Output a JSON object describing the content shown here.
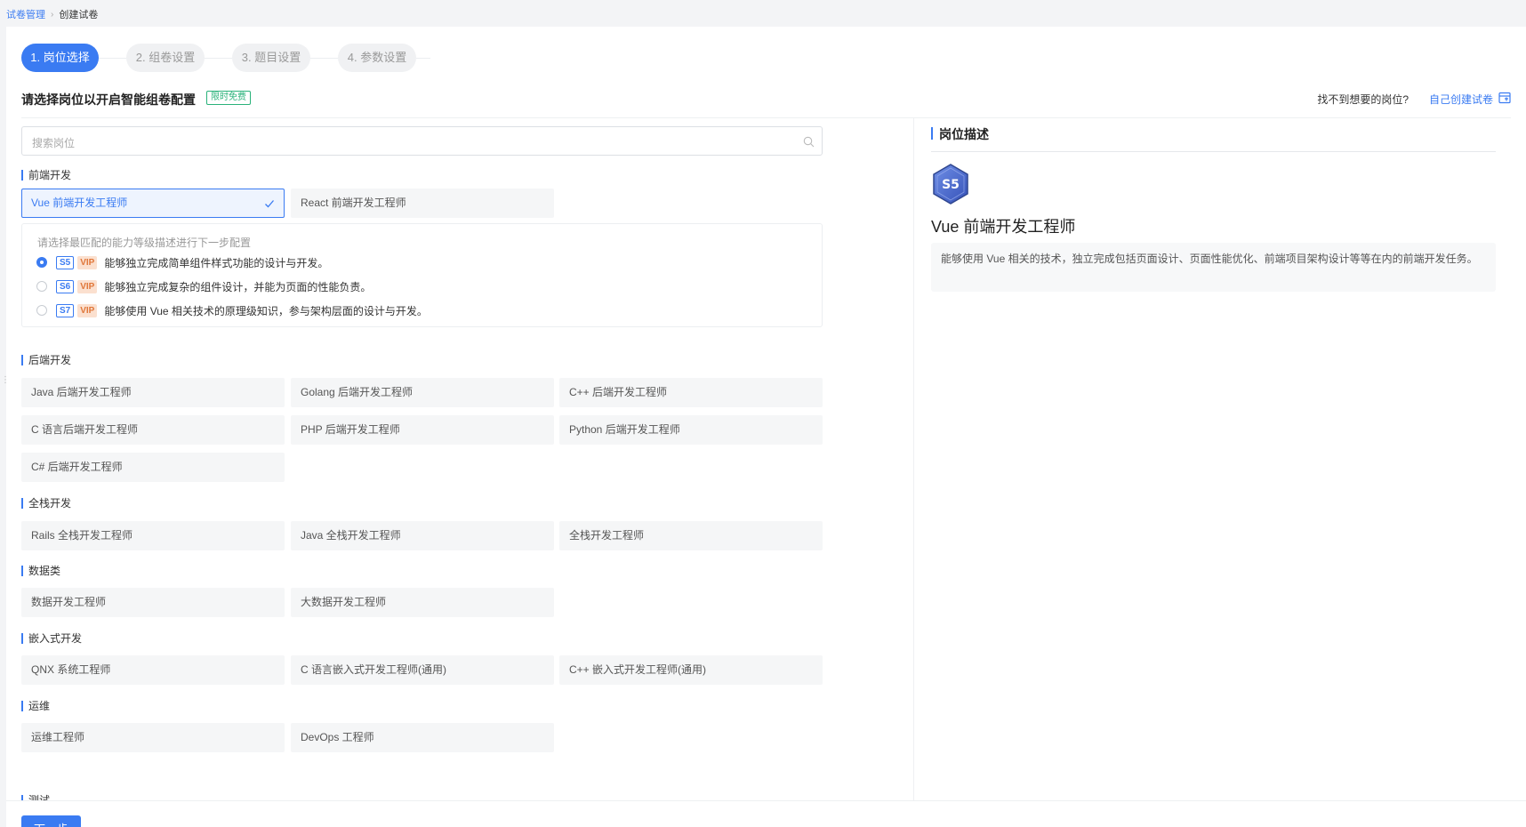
{
  "breadcrumb": {
    "parent": "试卷管理",
    "current": "创建试卷"
  },
  "steps": [
    "1. 岗位选择",
    "2. 组卷设置",
    "3. 题目设置",
    "4. 参数设置"
  ],
  "header": {
    "title": "请选择岗位以开启智能组卷配置",
    "badge": "限时免费",
    "cant_find": "找不到想要的岗位?",
    "self_create": "自己创建试卷"
  },
  "search": {
    "placeholder": "搜索岗位"
  },
  "categories": {
    "frontend": {
      "label": "前端开发",
      "items": [
        "Vue 前端开发工程师",
        "React 前端开发工程师"
      ]
    },
    "backend": {
      "label": "后端开发",
      "items": [
        "Java 后端开发工程师",
        "Golang 后端开发工程师",
        "C++ 后端开发工程师",
        "C 语言后端开发工程师",
        "PHP 后端开发工程师",
        "Python 后端开发工程师",
        "C# 后端开发工程师"
      ]
    },
    "fullstack": {
      "label": "全栈开发",
      "items": [
        "Rails 全栈开发工程师",
        "Java 全栈开发工程师",
        "全栈开发工程师"
      ]
    },
    "data": {
      "label": "数据类",
      "items": [
        "数据开发工程师",
        "大数据开发工程师"
      ]
    },
    "embedded": {
      "label": "嵌入式开发",
      "items": [
        "QNX 系统工程师",
        "C 语言嵌入式开发工程师(通用)",
        "C++ 嵌入式开发工程师(通用)"
      ]
    },
    "ops": {
      "label": "运维",
      "items": [
        "运维工程师",
        "DevOps 工程师"
      ]
    },
    "test": {
      "label": "测试"
    }
  },
  "levels": {
    "hint": "请选择最匹配的能力等级描述进行下一步配置",
    "vip": "VIP",
    "items": [
      {
        "tag": "S5",
        "text": "能够独立完成简单组件样式功能的设计与开发。"
      },
      {
        "tag": "S6",
        "text": "能够独立完成复杂的组件设计，并能为页面的性能负责。"
      },
      {
        "tag": "S7",
        "text": "能够使用 Vue 相关技术的原理级知识，参与架构层面的设计与开发。"
      }
    ]
  },
  "description": {
    "heading": "岗位描述",
    "badge": "S5",
    "title": "Vue 前端开发工程师",
    "text": "能够使用 Vue 相关的技术，独立完成包括页面设计、页面性能优化、前端项目架构设计等等在内的前端开发任务。"
  },
  "footer": {
    "next": "下一步"
  },
  "colors": {
    "accent": "#3a7bf2",
    "free": "#29b27a",
    "vip_bg": "#fbe0cf",
    "vip_text": "#e0773a"
  }
}
